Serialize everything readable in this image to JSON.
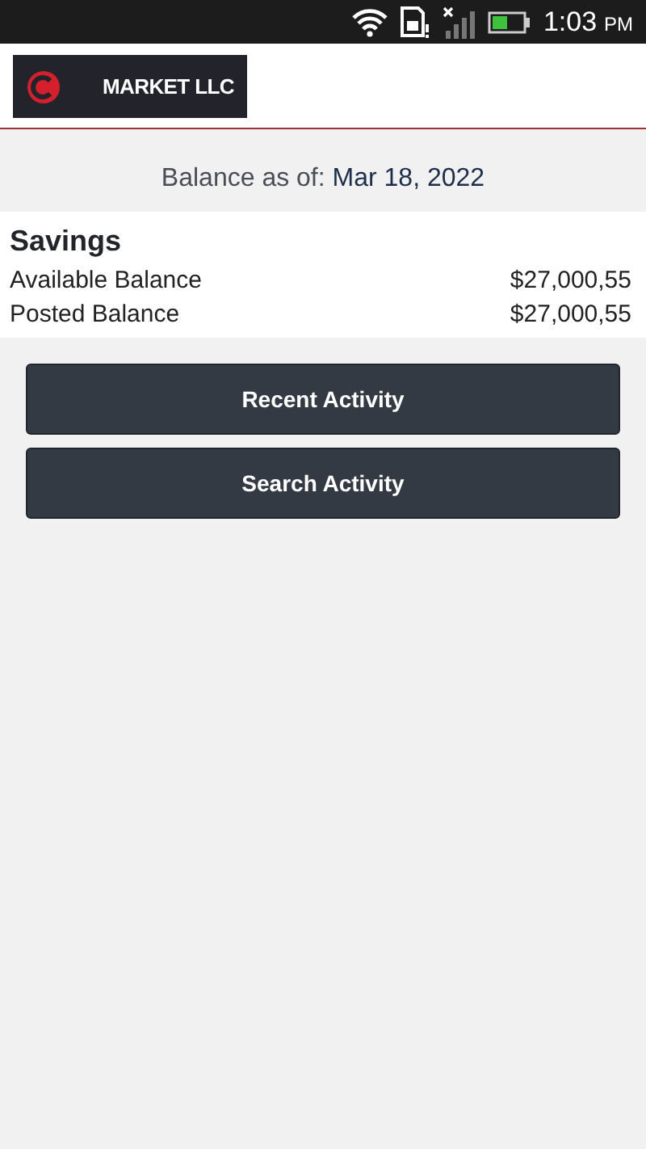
{
  "status_bar": {
    "time": "1:03",
    "meridiem": "PM"
  },
  "header": {
    "logo_text": "MARKET LLC"
  },
  "balance_date": {
    "label": "Balance as of:",
    "date": "Mar 18, 2022"
  },
  "account": {
    "name": "Savings",
    "rows": [
      {
        "label": "Available Balance",
        "amount": "$27,000,55"
      },
      {
        "label": "Posted Balance",
        "amount": "$27,000,55"
      }
    ]
  },
  "buttons": [
    "Recent Activity",
    "Search Activity"
  ]
}
